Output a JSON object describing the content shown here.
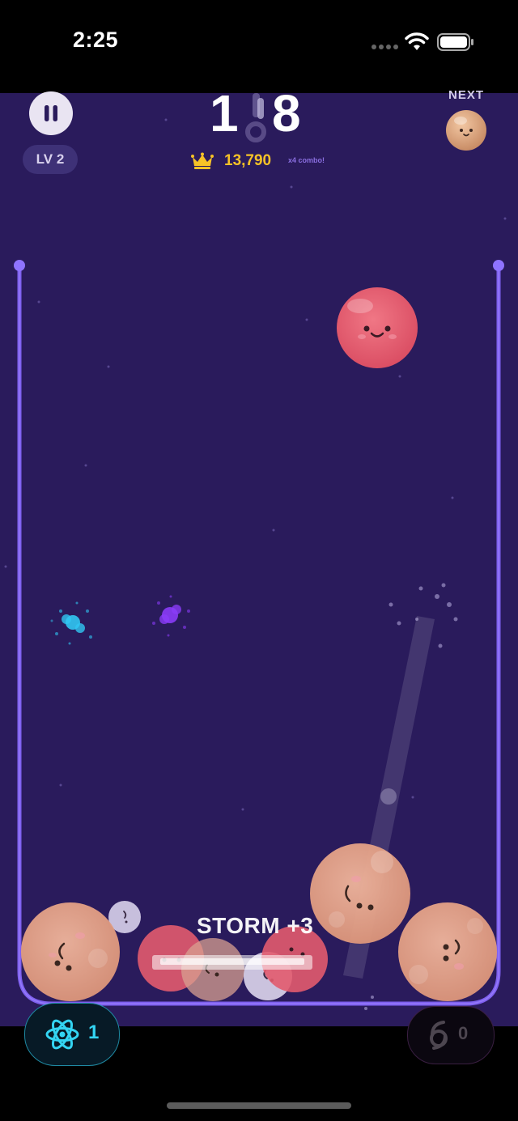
{
  "status": {
    "time": "2:25"
  },
  "hud": {
    "level": "LV 2",
    "score_left": "1",
    "score_right": "8",
    "best_score": "13,790",
    "combo": "x4 combo!",
    "next_label": "NEXT"
  },
  "popup": {
    "storm_text": "STORM +3"
  },
  "powerups": {
    "atom_count": "1",
    "storm_count": "0"
  },
  "colors": {
    "background": "#2a1b5c",
    "container": "#8a6ef0",
    "gold": "#f6c227",
    "atom": "#33d4f2",
    "peach_ball": "#e7a58c",
    "red_ball": "#e25b6e"
  }
}
